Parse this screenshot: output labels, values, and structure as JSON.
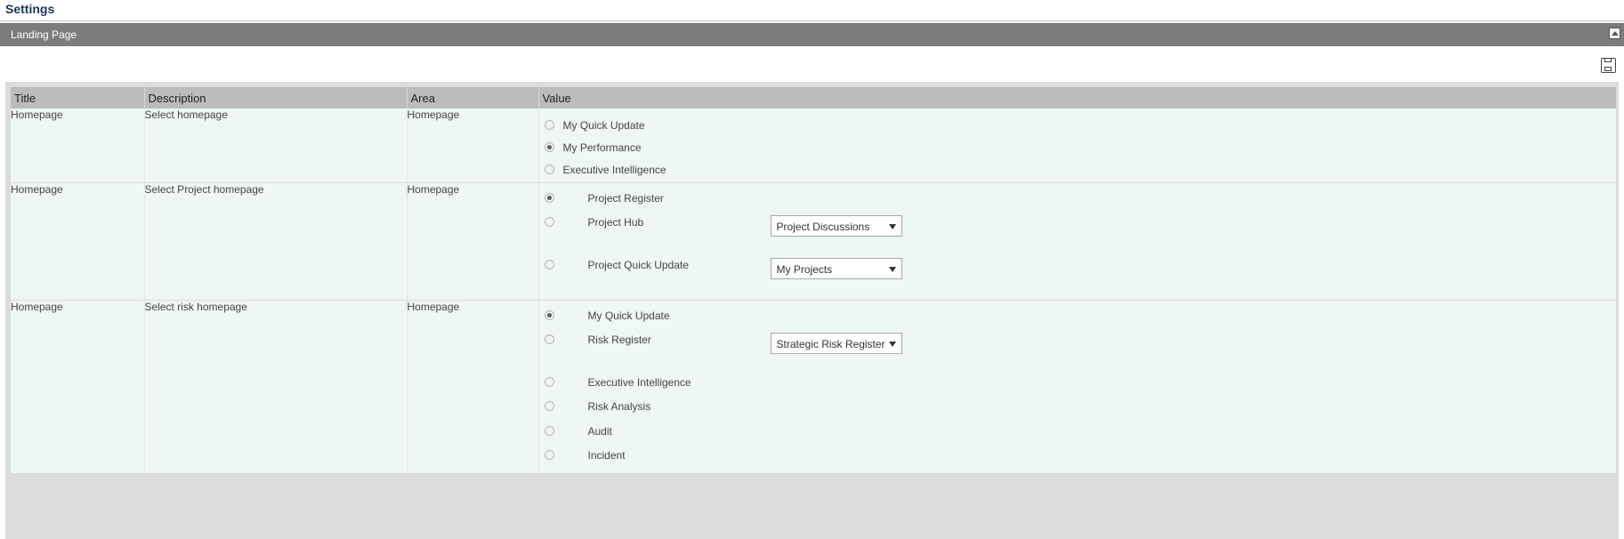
{
  "page": {
    "title": "Settings"
  },
  "section": {
    "title": "Landing Page"
  },
  "table": {
    "headers": [
      "Title",
      "Description",
      "Area",
      "Value"
    ],
    "rows": [
      {
        "title": "Homepage",
        "description": "Select homepage",
        "area": "Homepage",
        "options": [
          {
            "label": "My Quick Update",
            "checked": false
          },
          {
            "label": "My Performance",
            "checked": true
          },
          {
            "label": "Executive Intelligence",
            "checked": false
          }
        ]
      },
      {
        "title": "Homepage",
        "description": "Select Project homepage",
        "area": "Homepage",
        "options": [
          {
            "label": "Project Register",
            "checked": true
          },
          {
            "label": "Project Hub",
            "checked": false,
            "select": "Project Discussions"
          },
          {
            "label": "Project Quick Update",
            "checked": false,
            "select": "My Projects"
          }
        ]
      },
      {
        "title": "Homepage",
        "description": "Select risk homepage",
        "area": "Homepage",
        "options": [
          {
            "label": "My Quick Update",
            "checked": true
          },
          {
            "label": "Risk Register",
            "checked": false,
            "select": "Strategic Risk Register"
          },
          {
            "label": "Executive Intelligence",
            "checked": false
          },
          {
            "label": "Risk Analysis",
            "checked": false
          },
          {
            "label": "Audit",
            "checked": false
          },
          {
            "label": "Incident",
            "checked": false
          }
        ]
      }
    ]
  }
}
